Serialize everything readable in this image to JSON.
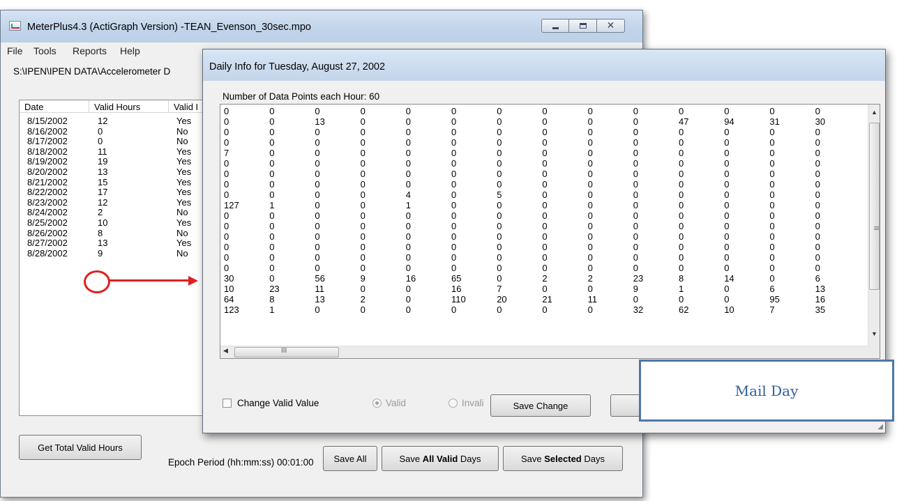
{
  "main_window": {
    "title": "MeterPlus4.3 (ActiGraph Version) -TEAN_Evenson_30sec.mpo",
    "menu": [
      "File",
      "Tools",
      "Reports",
      "Help"
    ],
    "path": "S:\\IPEN\\IPEN DATA\\Accelerometer D",
    "list": {
      "columns": [
        "Date",
        "Valid Hours",
        "Valid I"
      ],
      "rows": [
        [
          "8/15/2002",
          "12",
          "Yes"
        ],
        [
          "8/16/2002",
          "0",
          "No"
        ],
        [
          "8/17/2002",
          "0",
          "No"
        ],
        [
          "8/18/2002",
          "11",
          "Yes"
        ],
        [
          "8/19/2002",
          "19",
          "Yes"
        ],
        [
          "8/20/2002",
          "13",
          "Yes"
        ],
        [
          "8/21/2002",
          "15",
          "Yes"
        ],
        [
          "8/22/2002",
          "17",
          "Yes"
        ],
        [
          "8/23/2002",
          "12",
          "Yes"
        ],
        [
          "8/24/2002",
          "2",
          "No"
        ],
        [
          "8/25/2002",
          "10",
          "Yes"
        ],
        [
          "8/26/2002",
          "8",
          "No"
        ],
        [
          "8/27/2002",
          "13",
          "Yes"
        ],
        [
          "8/28/2002",
          "9",
          "No"
        ]
      ]
    },
    "buttons": {
      "get_total": "Get Total Valid Hours",
      "save_all": "Save All",
      "save_valid_prefix": "Save ",
      "save_valid_bold": "All Valid",
      "save_valid_suffix": " Days",
      "save_selected_prefix": "Save ",
      "save_selected_bold": "Selected",
      "save_selected_suffix": " Days"
    },
    "epoch_label": "Epoch Period (hh:mm:ss) 00:01:00"
  },
  "dialog": {
    "title": "Daily Info for Tuesday, August 27, 2002",
    "datapoints_label": "Number of Data Points each Hour: 60",
    "grid": [
      [
        "0",
        "0",
        "0",
        "0",
        "0",
        "0",
        "0",
        "0",
        "0",
        "0",
        "0",
        "0",
        "0",
        "0"
      ],
      [
        "0",
        "0",
        "13",
        "0",
        "0",
        "0",
        "0",
        "0",
        "0",
        "0",
        "47",
        "94",
        "31",
        "30"
      ],
      [
        "0",
        "0",
        "0",
        "0",
        "0",
        "0",
        "0",
        "0",
        "0",
        "0",
        "0",
        "0",
        "0",
        "0"
      ],
      [
        "0",
        "0",
        "0",
        "0",
        "0",
        "0",
        "0",
        "0",
        "0",
        "0",
        "0",
        "0",
        "0",
        "0"
      ],
      [
        "7",
        "0",
        "0",
        "0",
        "0",
        "0",
        "0",
        "0",
        "0",
        "0",
        "0",
        "0",
        "0",
        "0"
      ],
      [
        "0",
        "0",
        "0",
        "0",
        "0",
        "0",
        "0",
        "0",
        "0",
        "0",
        "0",
        "0",
        "0",
        "0"
      ],
      [
        "0",
        "0",
        "0",
        "0",
        "0",
        "0",
        "0",
        "0",
        "0",
        "0",
        "0",
        "0",
        "0",
        "0"
      ],
      [
        "0",
        "0",
        "0",
        "0",
        "0",
        "0",
        "0",
        "0",
        "0",
        "0",
        "0",
        "0",
        "0",
        "0"
      ],
      [
        "0",
        "0",
        "0",
        "0",
        "4",
        "0",
        "5",
        "0",
        "0",
        "0",
        "0",
        "0",
        "0",
        "0"
      ],
      [
        "127",
        "1",
        "0",
        "0",
        "1",
        "0",
        "0",
        "0",
        "0",
        "0",
        "0",
        "0",
        "0",
        "0"
      ],
      [
        "0",
        "0",
        "0",
        "0",
        "0",
        "0",
        "0",
        "0",
        "0",
        "0",
        "0",
        "0",
        "0",
        "0"
      ],
      [
        "0",
        "0",
        "0",
        "0",
        "0",
        "0",
        "0",
        "0",
        "0",
        "0",
        "0",
        "0",
        "0",
        "0"
      ],
      [
        "0",
        "0",
        "0",
        "0",
        "0",
        "0",
        "0",
        "0",
        "0",
        "0",
        "0",
        "0",
        "0",
        "0"
      ],
      [
        "0",
        "0",
        "0",
        "0",
        "0",
        "0",
        "0",
        "0",
        "0",
        "0",
        "0",
        "0",
        "0",
        "0"
      ],
      [
        "0",
        "0",
        "0",
        "0",
        "0",
        "0",
        "0",
        "0",
        "0",
        "0",
        "0",
        "0",
        "0",
        "0"
      ],
      [
        "0",
        "0",
        "0",
        "0",
        "0",
        "0",
        "0",
        "0",
        "0",
        "0",
        "0",
        "0",
        "0",
        "0"
      ],
      [
        "30",
        "0",
        "56",
        "9",
        "16",
        "65",
        "0",
        "2",
        "2",
        "23",
        "8",
        "14",
        "0",
        "6"
      ],
      [
        "10",
        "23",
        "11",
        "0",
        "0",
        "16",
        "7",
        "0",
        "0",
        "9",
        "1",
        "0",
        "6",
        "13"
      ],
      [
        "64",
        "8",
        "13",
        "2",
        "0",
        "110",
        "20",
        "21",
        "11",
        "0",
        "0",
        "0",
        "95",
        "16"
      ],
      [
        "123",
        "1",
        "0",
        "0",
        "0",
        "0",
        "0",
        "0",
        "0",
        "32",
        "62",
        "10",
        "7",
        "35"
      ]
    ],
    "change_valid_label": "Change Valid Value",
    "radio_valid": "Valid",
    "radio_invalid": "Invali",
    "save_change": "Save Change",
    "hscroll_grip": "III",
    "vscroll_grip": "≡"
  },
  "callout": {
    "text": "Mail Day"
  },
  "colors": {
    "annotation": "#e02020",
    "callout_border": "#4f76a9",
    "callout_text": "#2e5e96"
  }
}
